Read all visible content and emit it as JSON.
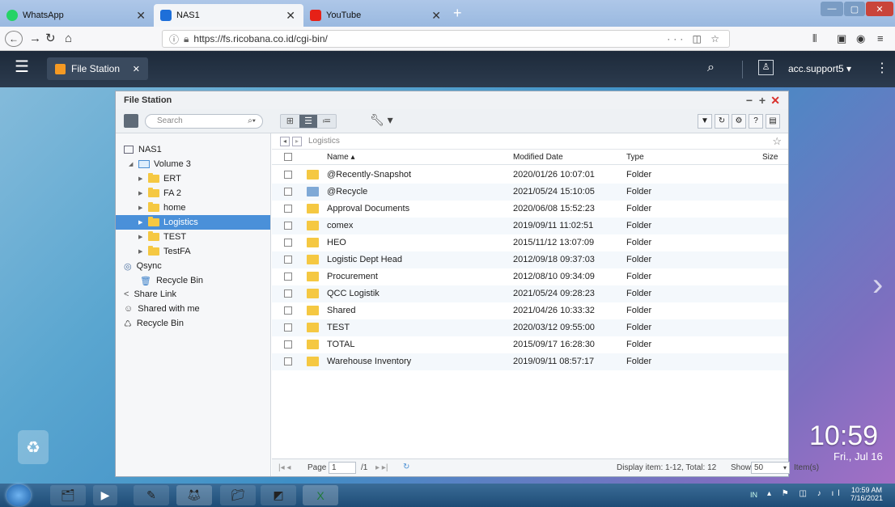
{
  "browser": {
    "tabs": [
      {
        "label": "WhatsApp",
        "color": "#25d366"
      },
      {
        "label": "NAS1",
        "color": "#1e6fd9"
      },
      {
        "label": "YouTube",
        "color": "#e62117"
      }
    ],
    "url": "https://fs.ricobana.co.id/cgi-bin/",
    "url_icon": "info-icon"
  },
  "qts": {
    "app_tab": "File Station",
    "user": "acc.support5 ▾"
  },
  "window": {
    "title": "File Station",
    "search_placeholder": "Search"
  },
  "sidebar": {
    "root": "NAS1",
    "volume": "Volume 3",
    "folders": [
      "ERT",
      "FA 2",
      "home",
      "Logistics",
      "TEST",
      "TestFA"
    ],
    "selected": "Logistics",
    "qsync": "Qsync",
    "qsync_recycle": "Recycle Bin",
    "share_link": "Share Link",
    "shared_with_me": "Shared with me",
    "recycle_bin": "Recycle Bin"
  },
  "path": {
    "current": "Logistics"
  },
  "table": {
    "headers": {
      "name": "Name ▴",
      "modified": "Modified Date",
      "type": "Type",
      "size": "Size"
    },
    "rows": [
      {
        "name": "@Recently-Snapshot",
        "modified": "2020/01/26 10:07:01",
        "type": "Folder"
      },
      {
        "name": "@Recycle",
        "modified": "2021/05/24 15:10:05",
        "type": "Folder"
      },
      {
        "name": "Approval Documents",
        "modified": "2020/06/08 15:52:23",
        "type": "Folder"
      },
      {
        "name": "comex",
        "modified": "2019/09/11 11:02:51",
        "type": "Folder"
      },
      {
        "name": "HEO",
        "modified": "2015/11/12 13:07:09",
        "type": "Folder"
      },
      {
        "name": "Logistic Dept Head",
        "modified": "2012/09/18 09:37:03",
        "type": "Folder"
      },
      {
        "name": "Procurement",
        "modified": "2012/08/10 09:34:09",
        "type": "Folder"
      },
      {
        "name": "QCC Logistik",
        "modified": "2021/05/24 09:28:23",
        "type": "Folder"
      },
      {
        "name": "Shared",
        "modified": "2021/04/26 10:33:32",
        "type": "Folder"
      },
      {
        "name": "TEST",
        "modified": "2020/03/12 09:55:00",
        "type": "Folder"
      },
      {
        "name": "TOTAL",
        "modified": "2015/09/17 16:28:30",
        "type": "Folder"
      },
      {
        "name": "Warehouse Inventory",
        "modified": "2019/09/11 08:57:17",
        "type": "Folder"
      }
    ]
  },
  "status": {
    "page_label": "Page",
    "page_value": "1",
    "page_total": "/1",
    "display": "Display item: 1-12, Total: 12",
    "show_label": "Show",
    "show_value": "50",
    "item_label": "Item(s)"
  },
  "desktop": {
    "clock": "10:59",
    "date": "Fri., Jul 16"
  },
  "taskbar": {
    "lang": "IN",
    "time": "10:59 AM",
    "date": "7/16/2021"
  }
}
